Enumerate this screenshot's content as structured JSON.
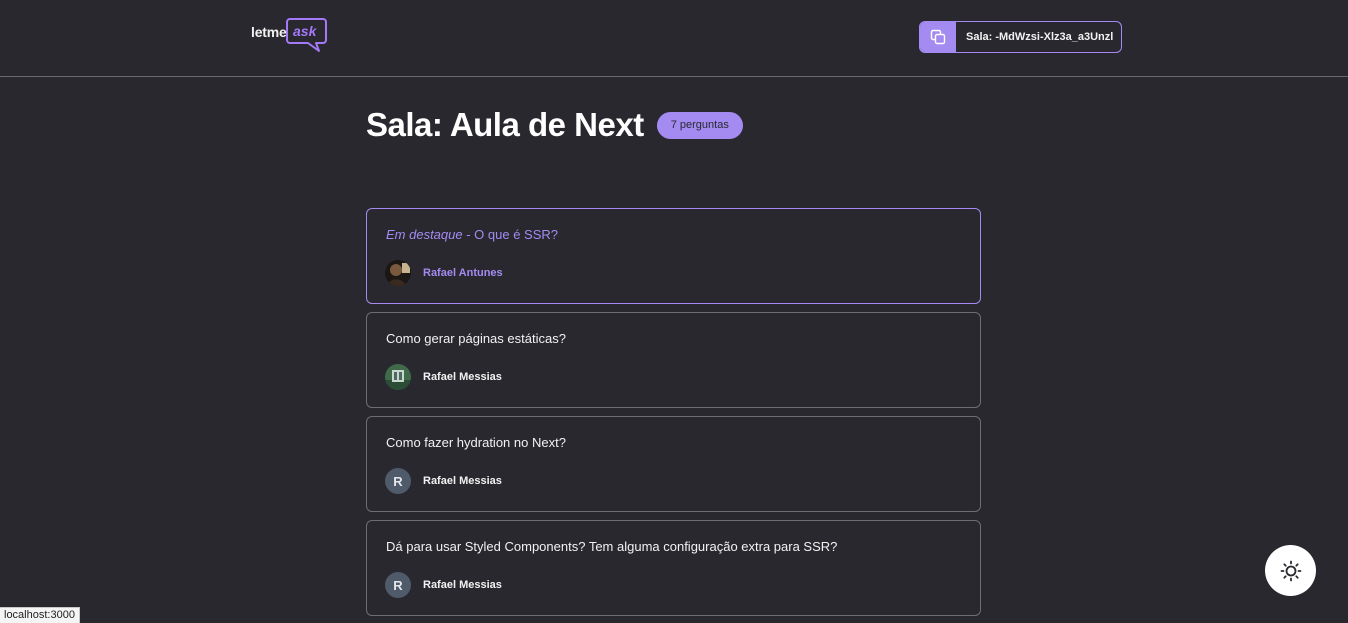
{
  "logo": {
    "part1": "letme",
    "part2": "ask"
  },
  "header": {
    "room_code_label": "Sala: -MdWzsi-Xlz3a_a3Unzl"
  },
  "room": {
    "title": "Sala: Aula de Next",
    "count_badge": "7 perguntas"
  },
  "questions": [
    {
      "highlight_label": "Em destaque",
      "separator": " - ",
      "text": "O que é SSR?",
      "author": "Rafael Antunes",
      "avatar": "photo-dark"
    },
    {
      "text": "Como gerar páginas estáticas?",
      "author": "Rafael Messias",
      "avatar": "photo-green"
    },
    {
      "text": "Como fazer hydration no Next?",
      "author": "Rafael Messias",
      "avatar_letter": "R"
    },
    {
      "text": "Dá para usar Styled Components? Tem alguma configuração extra para SSR?",
      "author": "Rafael Messias",
      "avatar_letter": "R"
    }
  ],
  "theme_toggle": {
    "icon": "sun-icon"
  },
  "status_bar": {
    "url": "localhost:3000"
  },
  "colors": {
    "accent": "#a38bf2",
    "background": "#29282e",
    "border": "#6e6d73"
  }
}
